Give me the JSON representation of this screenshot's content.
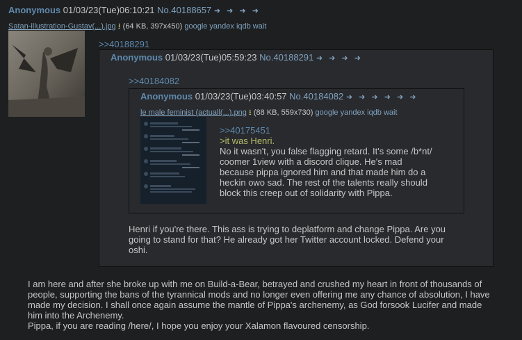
{
  "op": {
    "name": "Anonymous",
    "date": "01/03/23(Tue)06:10:21",
    "post_no": "No.40188657",
    "arrows": "➜ ➜ ➜ ➜",
    "file": {
      "name": "Satan-illustration-Gustav(...).jpg",
      "meta": "(64 KB, 397x450)",
      "services": "google yandex iqdb wait"
    },
    "quote_ref": ">>40188291",
    "body": [
      "I am here and after she broke up with me on Build-a-Bear, betrayed and crushed my heart in front of thousands of",
      "people, supporting the bans of the tyrannical mods and no longer even offering me any chance of absolution, I have",
      "made my decision. I shall once again assume the mantle of Pippa's archenemy, as God forsook Lucifer and made",
      "him into the Archenemy.",
      "Pippa, if you are reading /here/, I hope you enjoy your Xalamon flavoured censorship."
    ]
  },
  "reply1": {
    "name": "Anonymous",
    "date": "01/03/23(Tue)05:59:23",
    "post_no": "No.40188291",
    "arrows": "➜ ➜ ➜ ➜",
    "quote_ref": ">>40184082",
    "body": [
      "Henri if you're there. This ass is trying to deplatform and change Pippa. Are you",
      "going to stand for that? He already got her Twitter account locked. Defend your",
      "oshi."
    ]
  },
  "reply2": {
    "name": "Anonymous",
    "date": "01/03/23(Tue)03:40:57",
    "post_no": "No.40184082",
    "arrows": "➜ ➜ ➜ ➜ ➜ ➜",
    "file": {
      "name": "le male feminist (actuall(...).png",
      "meta": "(88 KB, 559x730)",
      "services": "google yandex iqdb wait"
    },
    "quote_ref": ">>40175451",
    "greentext": ">it was Henri.",
    "body": [
      "No it wasn't, you false flagging retard. It's some /b*nt/",
      "coomer 1view with a discord clique. He's mad",
      "because pippa ignored him and that made him do a",
      "heckin owo sad. The rest of the talents really should",
      "block this creep out of solidarity with Pippa."
    ]
  }
}
